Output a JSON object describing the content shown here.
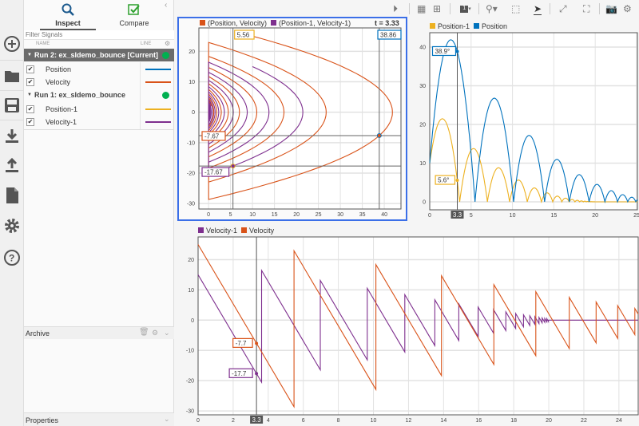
{
  "sidebar": {
    "icons": [
      "add-icon",
      "folder-icon",
      "save-icon",
      "download-icon",
      "upload-icon",
      "document-icon",
      "gear-icon",
      "help-icon"
    ]
  },
  "panel": {
    "tabs": [
      {
        "label": "Inspect",
        "icon": "search-icon",
        "active": true
      },
      {
        "label": "Compare",
        "icon": "compare-check-icon",
        "active": false
      }
    ],
    "filter_placeholder": "Filter Signals",
    "col_name": "NAME",
    "col_line": "LINE",
    "runs": [
      {
        "label": "Run 2: ex_sldemo_bounce [Current]",
        "status_color": "#00b050",
        "signals": [
          {
            "name": "Position",
            "checked": true,
            "color": "#0072bd"
          },
          {
            "name": "Velocity",
            "checked": true,
            "color": "#d95319"
          }
        ]
      },
      {
        "label": "Run 1: ex_sldemo_bounce",
        "status_color": "#00b050",
        "signals": [
          {
            "name": "Position-1",
            "checked": true,
            "color": "#edb120"
          },
          {
            "name": "Velocity-1",
            "checked": true,
            "color": "#7e2f8e"
          }
        ]
      }
    ],
    "archive": "Archive",
    "properties": "Properties"
  },
  "toolbar": {
    "icons": [
      "play-icon",
      "layout-grid-icon",
      "layout-subplot-icon",
      "subplot-number-icon",
      "zoom-icon",
      "fit-icon",
      "cursor-icon",
      "expand-icon",
      "fullscreen-icon",
      "camera-icon",
      "settings-icon"
    ],
    "subplot_number": "1"
  },
  "colors": {
    "Position": "#0072bd",
    "Velocity": "#d95319",
    "Position-1": "#edb120",
    "Velocity-1": "#7e2f8e",
    "selected_border": "#3b6fe8"
  },
  "chart_data": [
    {
      "type": "line",
      "plot": "xy",
      "legend": [
        "(Position, Velocity)",
        "(Position-1, Velocity-1)"
      ],
      "time_label": "t = 3.33",
      "xlim": [
        -2.2,
        43.8
      ],
      "ylim": [
        -31.8,
        27.7
      ],
      "xticks": [
        0,
        5,
        10,
        15,
        20,
        25,
        30,
        35,
        40
      ],
      "yticks": [
        -30,
        -20,
        -10,
        0,
        10,
        20
      ],
      "grid": true,
      "cursors": {
        "x": [
          5.56,
          38.86
        ],
        "y": [
          -7.67,
          -17.67
        ]
      },
      "cursor_labels": [
        "5.56",
        "38.86",
        "-7.67",
        "-17.67"
      ]
    },
    {
      "type": "line",
      "plot": "position",
      "legend": [
        "Position-1",
        "Position"
      ],
      "xlim": [
        0,
        25.1
      ],
      "ylim": [
        -2.06,
        43.7
      ],
      "xticks": [
        0,
        5,
        10,
        15,
        20,
        25
      ],
      "yticks": [
        0,
        10,
        20,
        30,
        40
      ],
      "grid": true,
      "cursor_t": "3.3",
      "cursor_values": [
        "38.9°",
        "5.6°"
      ]
    },
    {
      "type": "line",
      "plot": "velocity",
      "legend": [
        "Velocity-1",
        "Velocity"
      ],
      "xlim": [
        0,
        25.1
      ],
      "ylim": [
        -31.3,
        27.5
      ],
      "xticks": [
        0,
        2,
        4,
        6,
        8,
        10,
        12,
        14,
        16,
        18,
        20,
        22,
        24
      ],
      "yticks": [
        -30,
        -20,
        -10,
        0,
        10,
        20
      ],
      "grid": true,
      "cursor_t": "3.3",
      "cursor_values": [
        "-7.7",
        "-17.7"
      ]
    },
    {
      "type": "series",
      "initial_position": {
        "Position": 10,
        "Position-1": 10
      },
      "velocity": {
        "Velocity": [
          [
            0,
            25
          ],
          [
            5.47,
            -28.65
          ],
          [
            5.47,
            22.92
          ],
          [
            10.14,
            -22.92
          ],
          [
            10.14,
            18.34
          ],
          [
            13.88,
            -18.34
          ],
          [
            13.88,
            14.67
          ],
          [
            16.87,
            -14.67
          ],
          [
            16.87,
            11.74
          ],
          [
            19.26,
            -11.74
          ],
          [
            19.26,
            9.39
          ],
          [
            21.17,
            -9.39
          ],
          [
            21.17,
            7.51
          ],
          [
            22.7,
            -7.51
          ],
          [
            22.7,
            6.01
          ],
          [
            23.93,
            -6.01
          ],
          [
            23.93,
            4.81
          ],
          [
            24.91,
            -4.81
          ],
          [
            24.91,
            3.85
          ],
          [
            25.1,
            1.99
          ]
        ],
        "Velocity-1": [
          [
            0,
            15
          ],
          [
            3.62,
            -20.52
          ],
          [
            3.62,
            16.42
          ],
          [
            6.97,
            -16.42
          ],
          [
            6.97,
            13.13
          ],
          [
            9.65,
            -13.13
          ],
          [
            9.65,
            10.51
          ],
          [
            11.79,
            -10.51
          ],
          [
            11.79,
            8.41
          ],
          [
            13.5,
            -8.41
          ],
          [
            13.5,
            6.73
          ],
          [
            14.87,
            -6.73
          ],
          [
            14.87,
            5.38
          ],
          [
            15.97,
            -5.38
          ],
          [
            15.97,
            4.3
          ],
          [
            16.85,
            -4.3
          ],
          [
            16.85,
            3.44
          ],
          [
            17.55,
            -3.44
          ],
          [
            17.55,
            2.75
          ],
          [
            18.11,
            -2.75
          ],
          [
            18.11,
            2.2
          ],
          [
            18.56,
            -2.2
          ],
          [
            18.56,
            1.76
          ],
          [
            18.92,
            -1.76
          ],
          [
            18.92,
            1.41
          ],
          [
            19.21,
            -1.41
          ],
          [
            19.21,
            1.13
          ],
          [
            19.44,
            -1.13
          ],
          [
            19.44,
            0.9
          ],
          [
            19.62,
            -0.9
          ],
          [
            19.62,
            0.72
          ],
          [
            19.77,
            -0.72
          ],
          [
            19.77,
            0.58
          ],
          [
            19.89,
            -0.58
          ],
          [
            19.89,
            0.46
          ],
          [
            19.98,
            -0.46
          ],
          [
            19.98,
            0
          ],
          [
            25.1,
            0
          ]
        ]
      }
    }
  ]
}
